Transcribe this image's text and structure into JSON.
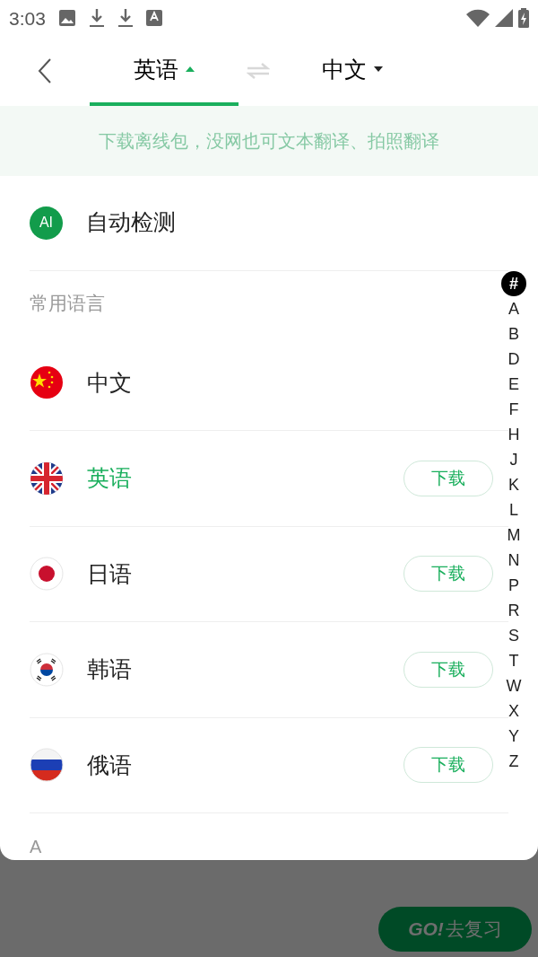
{
  "status_bar": {
    "time": "3:03"
  },
  "header": {
    "tabs": [
      {
        "label": "英语",
        "selected": true
      },
      {
        "label": "中文",
        "selected": false
      }
    ]
  },
  "banner": {
    "text": "下载离线包，没网也可文本翻译、拍照翻译"
  },
  "auto_detect": {
    "badge": "AI",
    "label": "自动检测"
  },
  "common_section": {
    "title": "常用语言",
    "languages": [
      {
        "name": "中文",
        "kind": "cn",
        "selected": false
      },
      {
        "name": "英语",
        "kind": "gb",
        "selected": true,
        "action": "下载"
      },
      {
        "name": "日语",
        "kind": "jp",
        "selected": false,
        "action": "下载"
      },
      {
        "name": "韩语",
        "kind": "kr",
        "selected": false,
        "action": "下载"
      },
      {
        "name": "俄语",
        "kind": "ru",
        "selected": false,
        "action": "下载"
      }
    ]
  },
  "next_section": {
    "title": "A"
  },
  "index": [
    {
      "label": "#",
      "selected": true
    },
    {
      "label": "A",
      "selected": false
    },
    {
      "label": "B",
      "selected": false
    },
    {
      "label": "D",
      "selected": false
    },
    {
      "label": "E",
      "selected": false
    },
    {
      "label": "F",
      "selected": false
    },
    {
      "label": "H",
      "selected": false
    },
    {
      "label": "J",
      "selected": false
    },
    {
      "label": "K",
      "selected": false
    },
    {
      "label": "L",
      "selected": false
    },
    {
      "label": "M",
      "selected": false
    },
    {
      "label": "N",
      "selected": false
    },
    {
      "label": "P",
      "selected": false
    },
    {
      "label": "R",
      "selected": false
    },
    {
      "label": "S",
      "selected": false
    },
    {
      "label": "T",
      "selected": false
    },
    {
      "label": "W",
      "selected": false
    },
    {
      "label": "X",
      "selected": false
    },
    {
      "label": "Y",
      "selected": false
    },
    {
      "label": "Z",
      "selected": false
    }
  ],
  "review_button": {
    "prefix": "GO!",
    "label": "去复习"
  }
}
